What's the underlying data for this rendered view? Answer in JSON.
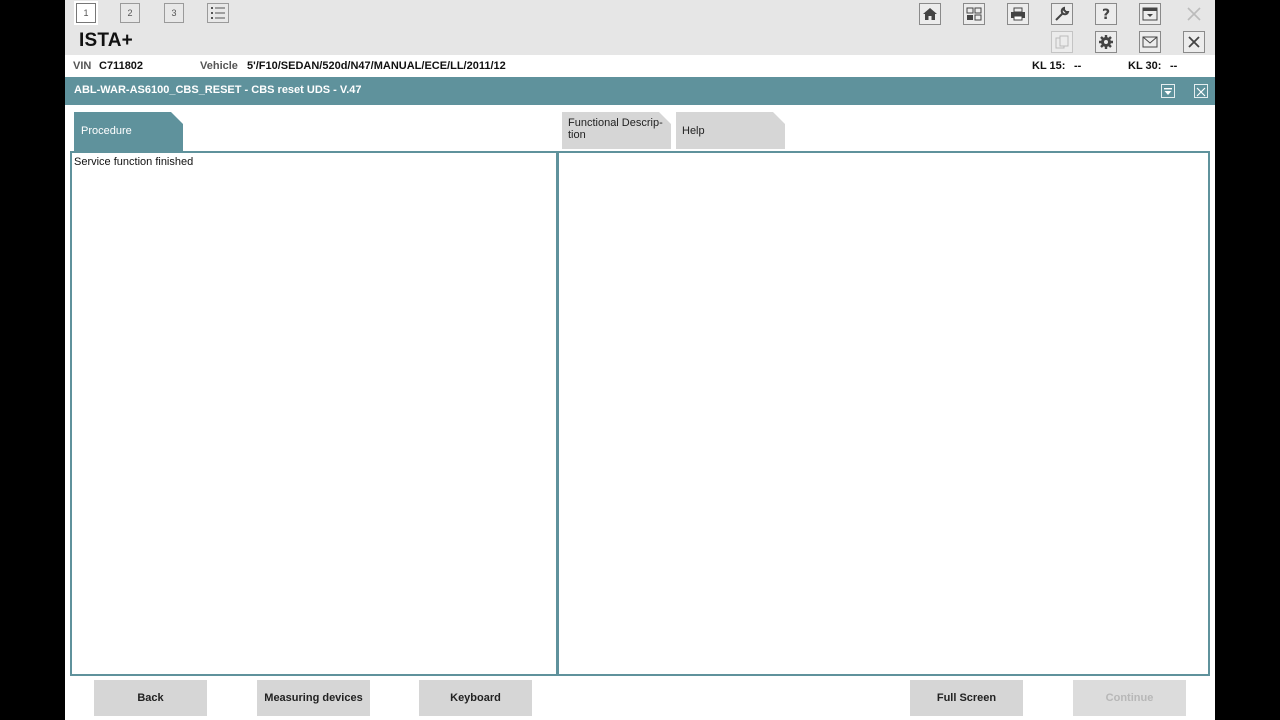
{
  "window_tabs": {
    "tab1": "1",
    "tab2": "2",
    "tab3": "3"
  },
  "toolbar_icons": [
    "home-icon",
    "tiles-icon",
    "printer-icon",
    "wrench-icon",
    "help-icon",
    "minimize-icon",
    "close-icon"
  ],
  "app": {
    "title": "ISTA+"
  },
  "secondary_icons": [
    "copy-icon",
    "settings-icon",
    "mail-icon",
    "close-icon"
  ],
  "vehicle_info": {
    "vin_label": "VIN",
    "vin_value": "C711802",
    "vehicle_label": "Vehicle",
    "vehicle_value": "5'/F10/SEDAN/520d/N47/MANUAL/ECE/LL/2011/12",
    "kl15_label": "KL 15:",
    "kl15_value": "--",
    "kl30_label": "KL 30:",
    "kl30_value": "--"
  },
  "header": {
    "title": "ABL-WAR-AS6100_CBS_RESET - CBS reset UDS - V.47"
  },
  "tabs": {
    "procedure": "Procedure",
    "functional_line1": "Functional Descrip-",
    "functional_line2": "tion",
    "help": "Help"
  },
  "procedure_panel": {
    "text": "Service function finished"
  },
  "buttons": {
    "back": "Back",
    "measuring": "Measuring devices",
    "keyboard": "Keyboard",
    "fullscreen": "Full Screen",
    "continue": "Continue"
  },
  "colors": {
    "accent": "#5f929c",
    "button_bg": "#d6d6d6",
    "toolbar_bg": "#e6e6e6"
  }
}
